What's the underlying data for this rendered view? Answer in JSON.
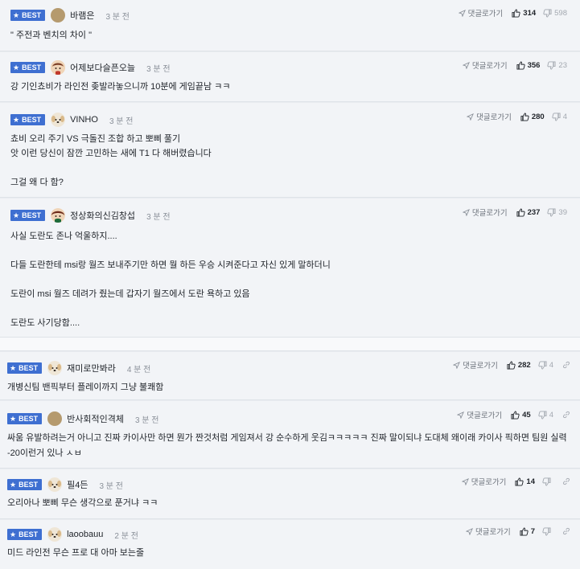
{
  "badge_label": "BEST",
  "reply_label": "댓글로가기",
  "comments": [
    {
      "nick": "바램은",
      "time": "3 분 전",
      "likes": "314",
      "dislikes": "598",
      "avatar": "circle",
      "body": "\" 주전과 벤치의 차이 \""
    },
    {
      "nick": "어제보다슬픈오늘",
      "time": "3 분 전",
      "likes": "356",
      "dislikes": "23",
      "avatar": "character",
      "body": "강 기인쵸비가 라인전 좆발라놓으니까 10분에 게임끝남 ㅋㅋ"
    },
    {
      "nick": "VINHO",
      "time": "3 분 전",
      "likes": "280",
      "dislikes": "4",
      "avatar": "puppy",
      "body": "쵸비 오리 주기 VS 극돌진 조합 하고 뽀삐 풀기\n앗 이런 당신이 잠깐 고민하는 새에 T1 다 해버렸습니다\n\n그걸 왜 다 함?"
    },
    {
      "nick": "정상화의신김창섭",
      "time": "3 분 전",
      "likes": "237",
      "dislikes": "39",
      "avatar": "character",
      "body": "사실 도란도 존나 억울하지....\n\n다들 도란한테 msi랑 월즈 보내주기만 하면 뭘 하든 우승 시켜준다고 자신 있게 말하더니\n\n도란이 msi 월즈 데려가 줬는데 갑자기 월즈에서 도란 욕하고 있음\n\n도란도 사기당함...."
    },
    {
      "nick": "재미로만봐라",
      "time": "4 분 전",
      "likes": "282",
      "dislikes": "4",
      "avatar": "puppy",
      "body": "개병신팀 밴픽부터 플레이까지 그냥 불쾌함"
    },
    {
      "nick": "반사회적인격체",
      "time": "3 분 전",
      "likes": "45",
      "dislikes": "4",
      "avatar": "circle",
      "body": "싸움 유발하려는거 아니고 진짜 카이사만 하면 뭔가 짠것처럼 게임져서 강 순수하게 웃김ㅋㅋㅋㅋㅋ 진짜 말이되냐 도대체 왜이래 카이사 픽하면 팀원 실력\n-20이런거 있나 ㅅㅂ"
    },
    {
      "nick": "필4든",
      "time": "3 분 전",
      "likes": "14",
      "dislikes": "",
      "avatar": "puppy",
      "body": "오리아나 뽀삐 무슨 생각으로 푼거냐 ㅋㅋ"
    },
    {
      "nick": "laoobauu",
      "time": "2 분 전",
      "likes": "7",
      "dislikes": "",
      "avatar": "puppy",
      "body": "미드 라인전 무슨 프로 대 아마 보는줄"
    }
  ]
}
